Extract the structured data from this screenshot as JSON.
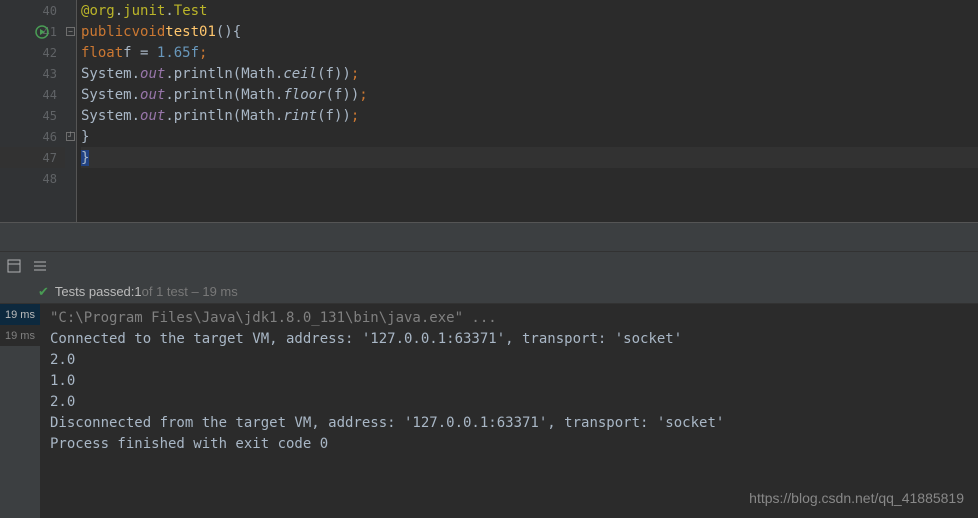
{
  "editor": {
    "lines": [
      {
        "num": "40"
      },
      {
        "num": "41"
      },
      {
        "num": "42"
      },
      {
        "num": "43"
      },
      {
        "num": "44"
      },
      {
        "num": "45"
      },
      {
        "num": "46"
      },
      {
        "num": "47"
      },
      {
        "num": "48"
      }
    ],
    "code": {
      "l40": {
        "at": "@",
        "pkg1": "org",
        "pkg2": "junit",
        "cls": "Test",
        "dot": "."
      },
      "l41": {
        "kw1": "public",
        "kw2": "void",
        "method": "test01",
        "parens": "()",
        "brace": "{"
      },
      "l42": {
        "kw": "float",
        "var": "f",
        "eq": " = ",
        "num": "1.65f",
        "semi": ";"
      },
      "l43": {
        "sys": "System",
        "out": "out",
        "println": "println",
        "math": "Math",
        "fn": "ceil",
        "arg": "f",
        "dot": ".",
        "lp": "(",
        "rp": ")",
        "semi": ";"
      },
      "l44": {
        "sys": "System",
        "out": "out",
        "println": "println",
        "math": "Math",
        "fn": "floor",
        "arg": "f",
        "dot": ".",
        "lp": "(",
        "rp": ")",
        "semi": ";"
      },
      "l45": {
        "sys": "System",
        "out": "out",
        "println": "println",
        "math": "Math",
        "fn": "rint",
        "arg": "f",
        "dot": ".",
        "lp": "(",
        "rp": ")",
        "semi": ";"
      },
      "l46": {
        "brace": "}"
      },
      "l47": {
        "brace": "}"
      }
    }
  },
  "test_status": {
    "prefix": "Tests passed: ",
    "count": "1",
    "suffix": " of 1 test – 19 ms"
  },
  "output": {
    "times": [
      "19 ms",
      "19 ms"
    ],
    "line1": "\"C:\\Program Files\\Java\\jdk1.8.0_131\\bin\\java.exe\" ...",
    "line2": "Connected to the target VM, address: '127.0.0.1:63371', transport: 'socket'",
    "line3": "2.0",
    "line4": "1.0",
    "line5": "2.0",
    "line6": "Disconnected from the target VM, address: '127.0.0.1:63371', transport: 'socket'",
    "line7": "",
    "line8": "Process finished with exit code 0"
  },
  "watermark": "https://blog.csdn.net/qq_41885819"
}
